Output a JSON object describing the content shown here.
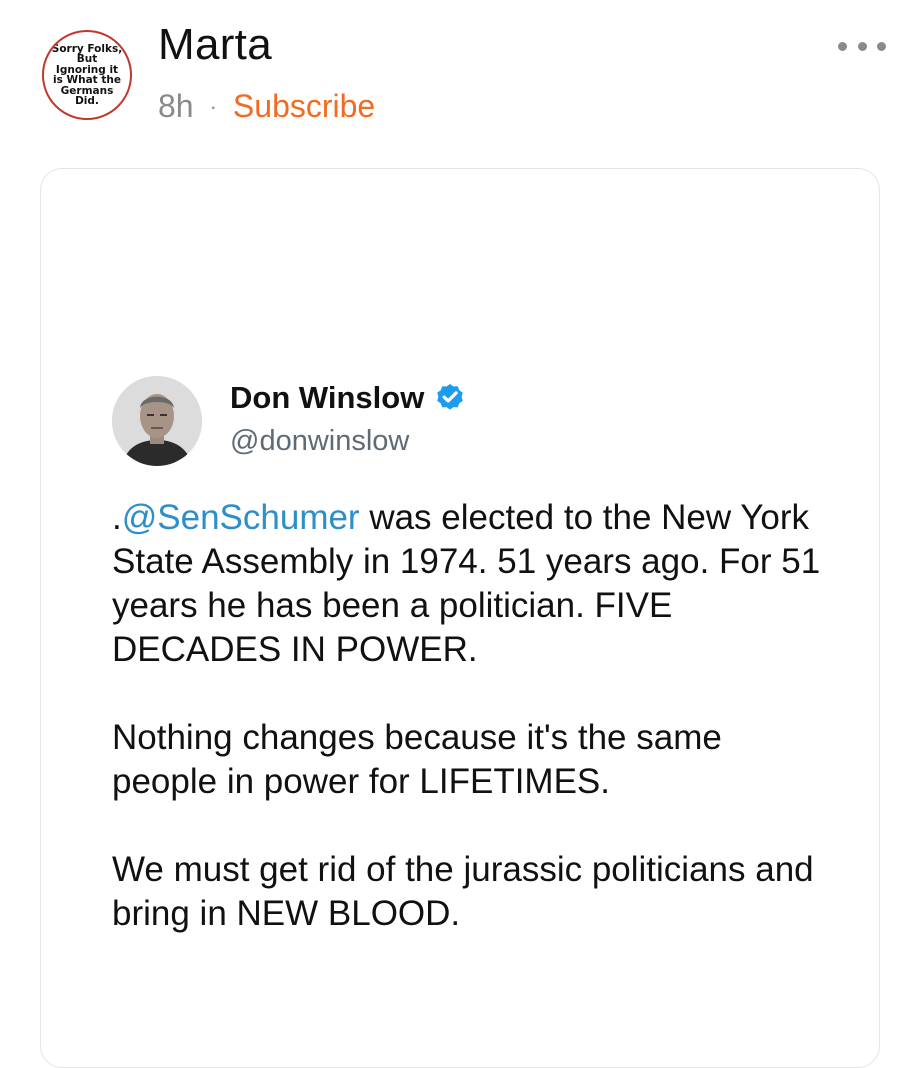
{
  "post": {
    "avatar_text": "Sorry Folks, But Ignoring it is What the Germans Did.",
    "author": "Marta",
    "time": "8h",
    "separator": "·",
    "subscribe_label": "Subscribe",
    "more_icon": "more-horizontal-icon"
  },
  "tweet": {
    "author": "Don Winslow",
    "handle": "@donwinslow",
    "verified_icon": "verified-badge-icon",
    "mention_prefix": ".",
    "mention": "@SenSchumer",
    "p1_rest": " was elected to the New York State Assembly in 1974. 51 years ago. For 51 years he has been a politician. FIVE DECADES IN POWER.",
    "p2": "Nothing changes because it's the same people in power for LIFETIMES.",
    "p3": "We must get rid of the jurassic politicians and bring in NEW BLOOD."
  },
  "colors": {
    "accent": "#f26b21",
    "mention": "#2d8fc9",
    "verified": "#1d9bf0",
    "muted": "#8a8a8a"
  }
}
